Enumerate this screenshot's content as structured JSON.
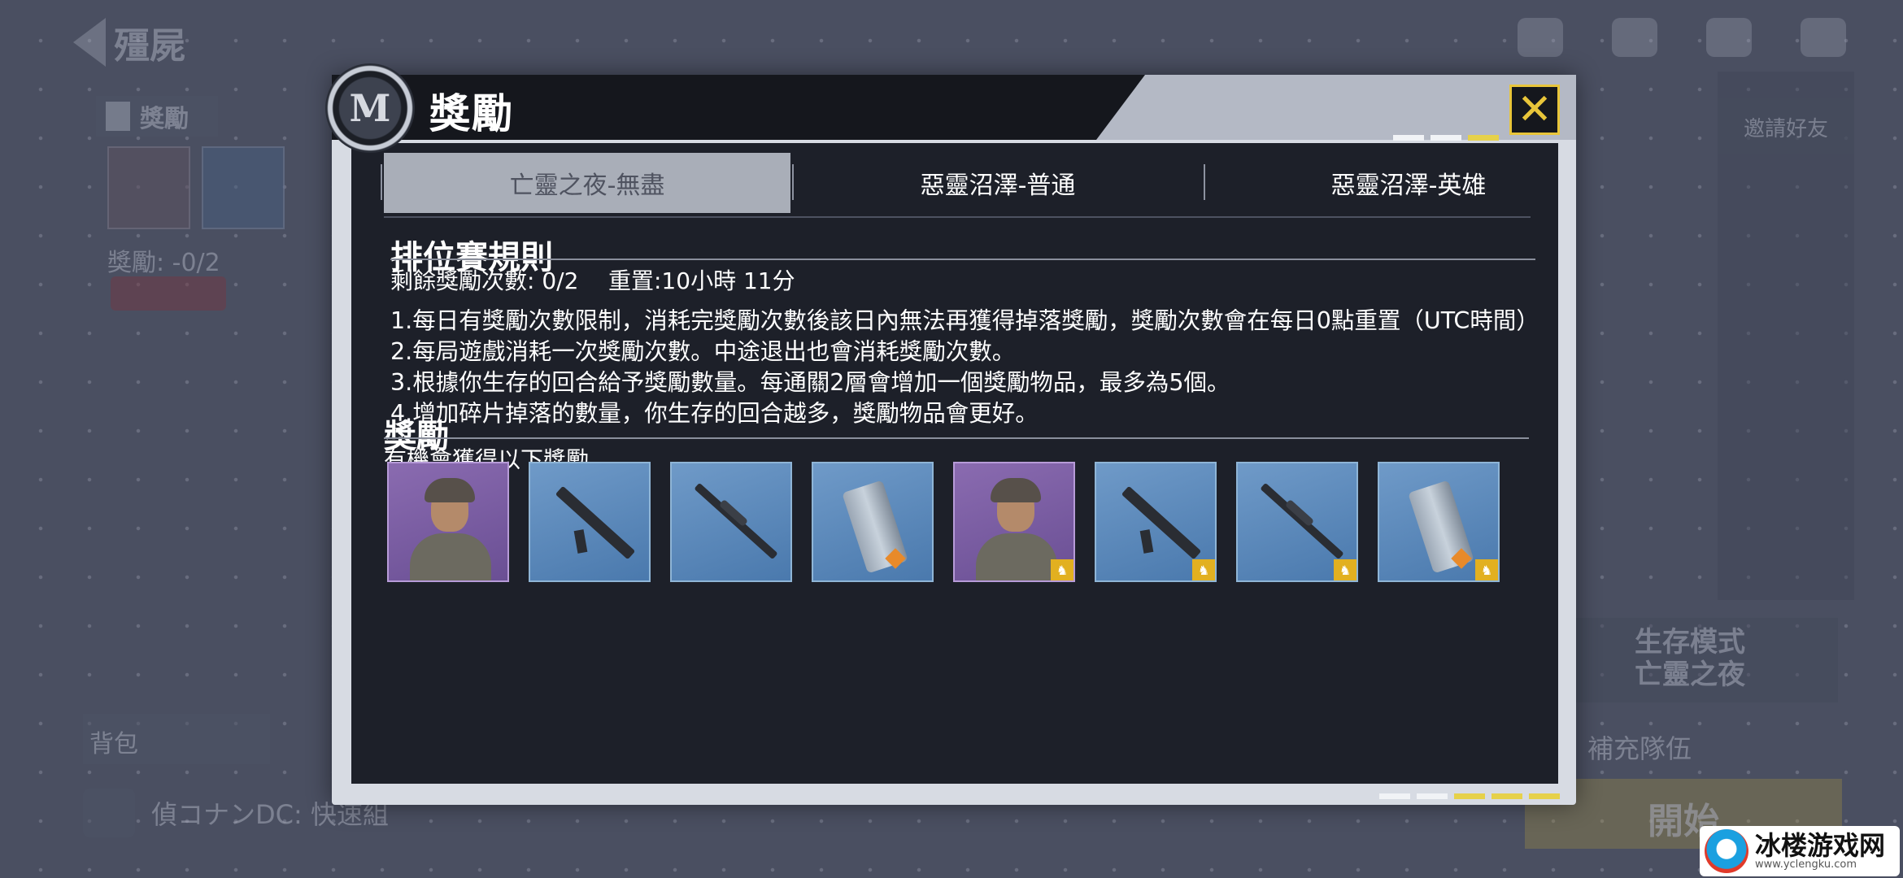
{
  "background": {
    "back_title": "殭屍",
    "reward_tag": "獎勵",
    "reward_count": "獎勵: -0/2",
    "bag_label": "背包",
    "chat_text": "偵コナンDC: 快速組",
    "right_button": "邀請好友",
    "mode_line1": "生存模式",
    "mode_line2": "亡靈之夜",
    "refill_label": "補充隊伍",
    "start_label": "開始"
  },
  "watermark": {
    "main": "冰楼游戏网",
    "sub": "www.yclengku.com"
  },
  "dialog": {
    "emblem": "M",
    "title": "獎勵",
    "close_icon": "close-x-icon",
    "accent_color": "#e8c53a",
    "tabs": [
      {
        "label": "亡靈之夜-無盡",
        "active": true
      },
      {
        "label": "惡靈沼澤-普通",
        "active": false
      },
      {
        "label": "惡靈沼澤-英雄",
        "active": false
      }
    ],
    "rules_title": "排位賽規則",
    "remaining_label": "剩餘獎勵次數: 0/2",
    "reset_label": "重置:10小時 11分",
    "rules": [
      "1.每日有獎勵次數限制，消耗完獎勵次數後該日內無法再獲得掉落獎勵，獎勵次數會在每日0點重置（UTC時間）",
      "2.每局遊戲消耗一次獎勵次數。中途退出也會消耗獎勵次數。",
      "3.根據你生存的回合給予獎勵數量。每通關2層會增加一個獎勵物品，最多為5個。",
      "4.增加碎片掉落的數量，你生存的回合越多，獎勵物品會更好。"
    ],
    "rewards_title": "獎勵",
    "rewards_subtitle": "有機會獲得以下獎勵",
    "items": [
      {
        "kind": "character",
        "icon": "soldier-portrait-icon",
        "bonus": false
      },
      {
        "kind": "rifle",
        "icon": "assault-rifle-icon",
        "bonus": false
      },
      {
        "kind": "sniper",
        "icon": "sniper-rifle-icon",
        "bonus": false
      },
      {
        "kind": "launcher",
        "icon": "launcher-icon",
        "bonus": false
      },
      {
        "kind": "character",
        "icon": "soldier-portrait-icon",
        "bonus": true
      },
      {
        "kind": "rifle",
        "icon": "assault-rifle-icon",
        "bonus": true
      },
      {
        "kind": "sniper",
        "icon": "sniper-rifle-icon",
        "bonus": true
      },
      {
        "kind": "launcher",
        "icon": "launcher-icon",
        "bonus": true
      }
    ]
  }
}
